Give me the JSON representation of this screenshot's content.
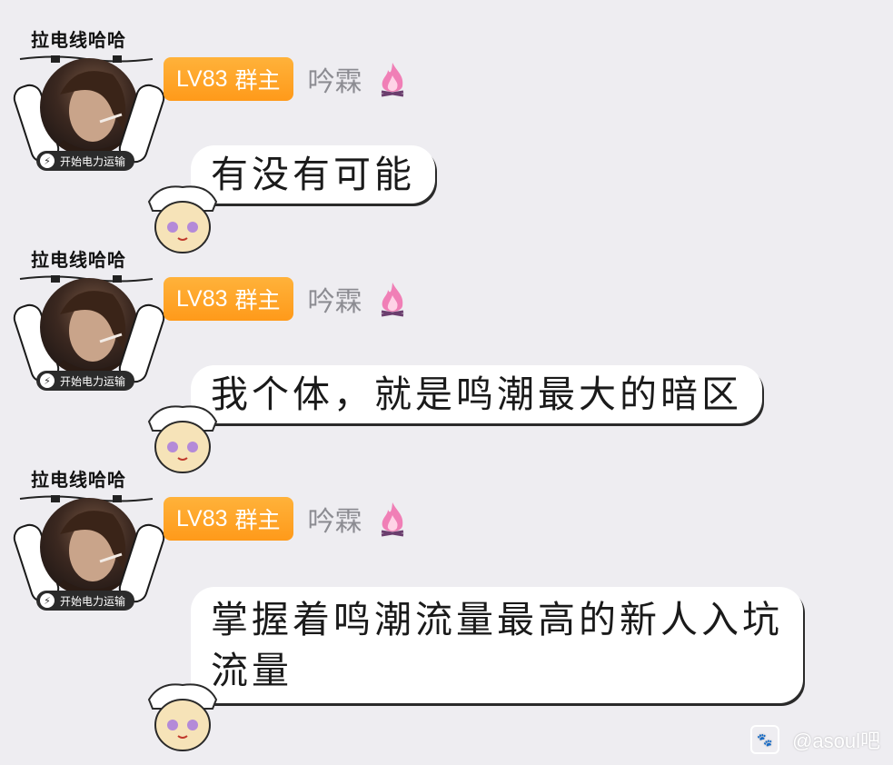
{
  "messages": [
    {
      "frame_title": "拉电线哈哈",
      "power_label": "开始电力运输",
      "level": "LV83",
      "role": "群主",
      "username": "吟霖",
      "lines": [
        "有没有可能"
      ]
    },
    {
      "frame_title": "拉电线哈哈",
      "power_label": "开始电力运输",
      "level": "LV83",
      "role": "群主",
      "username": "吟霖",
      "lines": [
        "我个体，就是鸣潮最大的暗区"
      ]
    },
    {
      "frame_title": "拉电线哈哈",
      "power_label": "开始电力运输",
      "level": "LV83",
      "role": "群主",
      "username": "吟霖",
      "lines": [
        "掌握着鸣潮流量最高的新人入坑",
        "流量"
      ]
    }
  ],
  "watermark": {
    "text": "@asoul吧",
    "icon": "paw-icon"
  },
  "colors": {
    "background": "#eeedf1",
    "badge": "#ffa424",
    "username": "#8c8c92",
    "bubble": "#ffffff"
  },
  "icons": {
    "bolt": "bolt-icon",
    "flame": "flame-icon"
  }
}
